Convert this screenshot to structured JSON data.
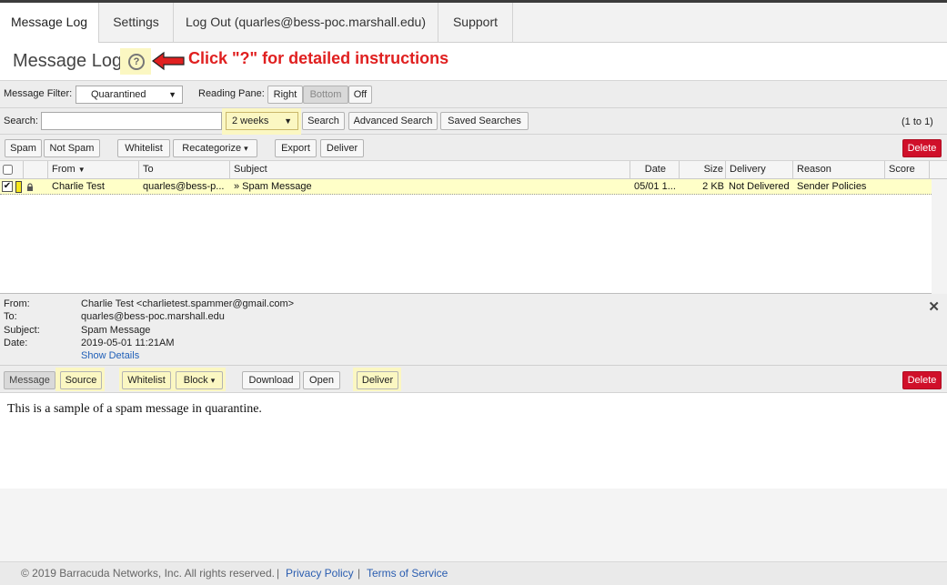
{
  "tabs": [
    {
      "label": "Message Log"
    },
    {
      "label": "Settings"
    },
    {
      "label": "Log Out (quarles@bess-poc.marshall.edu)"
    },
    {
      "label": "Support"
    }
  ],
  "title": {
    "text": "Message Log",
    "help_label": "?",
    "instruction": "Click \"?\" for detailed instructions"
  },
  "filter_bar": {
    "filter_label": "Message Filter:",
    "filter_value": "Quarantined",
    "pane_label": "Reading Pane:",
    "pane_options": [
      "Right",
      "Bottom",
      "Off"
    ]
  },
  "search_bar": {
    "label": "Search:",
    "value": "",
    "period": "2 weeks",
    "search_btn": "Search",
    "advanced_btn": "Advanced Search",
    "saved_btn": "Saved Searches",
    "count": "(1 to 1)"
  },
  "actions": {
    "spam": "Spam",
    "not_spam": "Not Spam",
    "whitelist": "Whitelist",
    "recategorize": "Recategorize",
    "export": "Export",
    "deliver": "Deliver",
    "delete": "Delete"
  },
  "grid": {
    "columns": [
      "From",
      "To",
      "Subject",
      "Date",
      "Size",
      "Delivery",
      "Reason",
      "Score"
    ],
    "rows": [
      {
        "from": "Charlie Test",
        "to": "quarles@bess-p...",
        "subject": "» Spam Message",
        "date": "05/01 1...",
        "size": "2 KB",
        "delivery": "Not Delivered",
        "reason": "Sender Policies",
        "score": ""
      }
    ]
  },
  "detail": {
    "from_label": "From:",
    "from_value": "Charlie Test <charlietest.spammer@gmail.com>",
    "to_label": "To:",
    "to_value": "quarles@bess-poc.marshall.edu",
    "subject_label": "Subject:",
    "subject_value": "Spam Message",
    "date_label": "Date:",
    "date_value": "2019-05-01 11:21AM",
    "show_details": "Show Details"
  },
  "preview_actions": {
    "message": "Message",
    "source": "Source",
    "whitelist": "Whitelist",
    "block": "Block",
    "download": "Download",
    "open": "Open",
    "deliver": "Deliver",
    "delete": "Delete"
  },
  "message_body": "This is a sample of a spam message in quarantine.",
  "footer": {
    "copyright": "© 2019 Barracuda Networks, Inc. All rights reserved.",
    "sep": "|",
    "privacy": "Privacy Policy",
    "terms": "Terms of Service"
  },
  "colors": {
    "highlight": "#fbf7c2",
    "delete": "#d0102a",
    "annotation": "#e02020",
    "row_selected": "#ffffc8",
    "link": "#2160b8"
  }
}
